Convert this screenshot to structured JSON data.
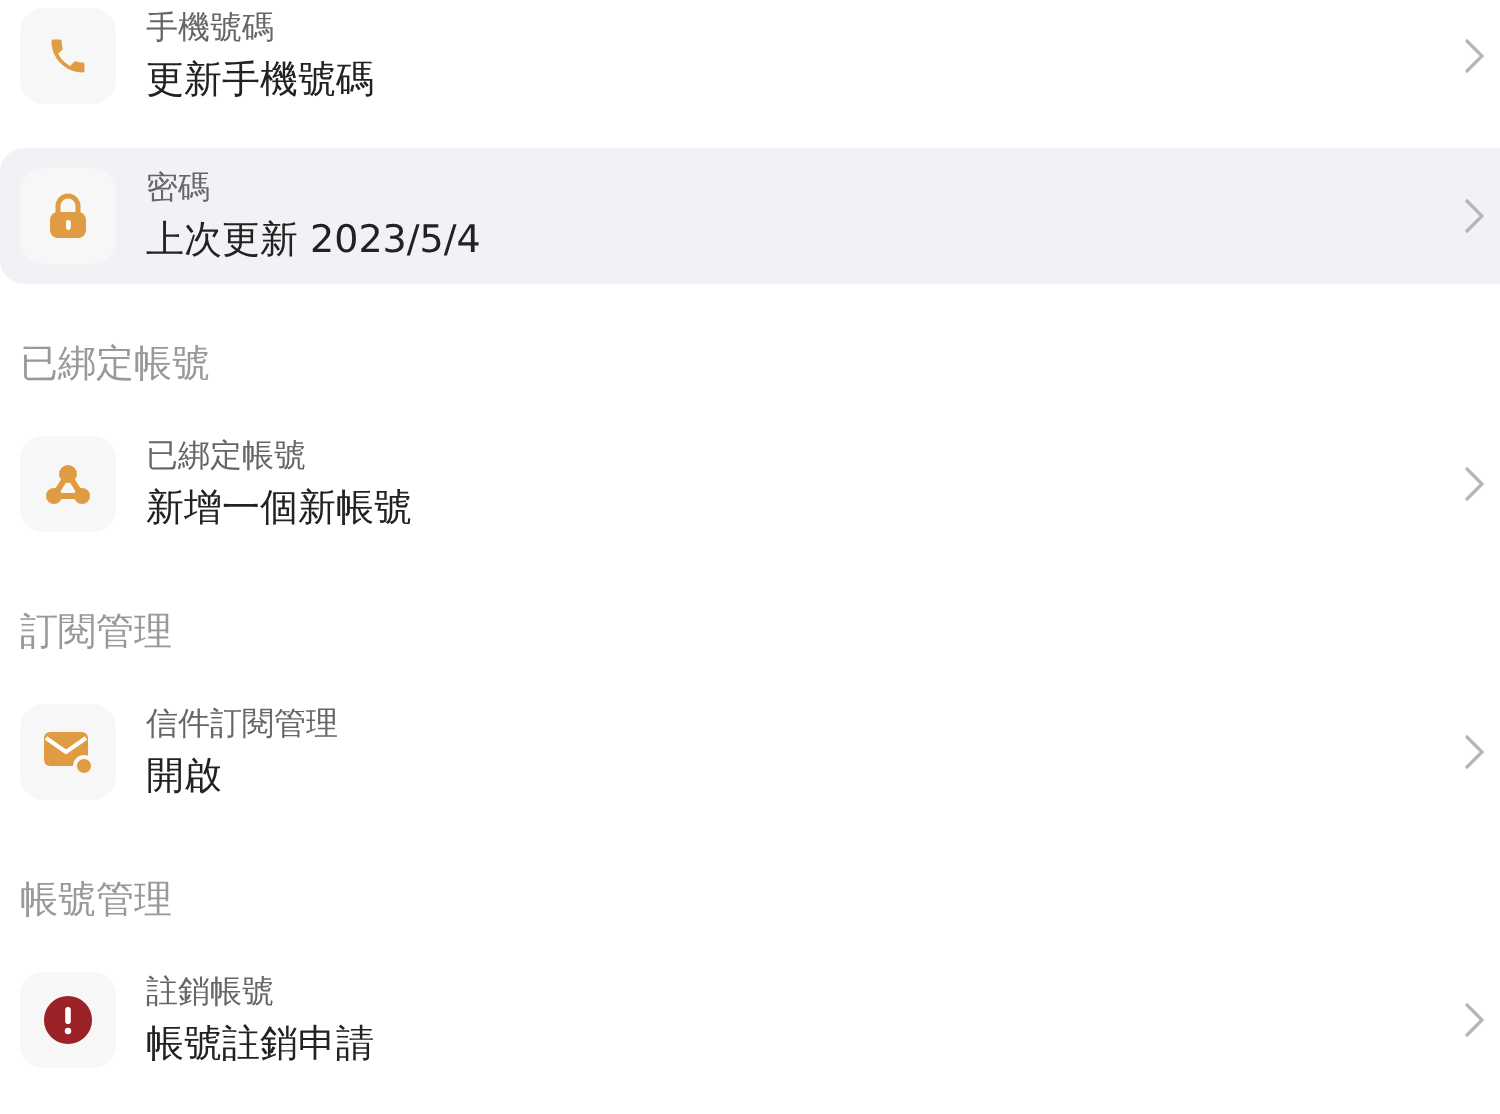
{
  "sections": [
    {
      "items": [
        {
          "kind": "phone",
          "title": "手機號碼",
          "value": "更新手機號碼",
          "selected": false
        },
        {
          "kind": "lock",
          "title": "密碼",
          "value": "上次更新 2023/5/4",
          "selected": true
        }
      ]
    },
    {
      "header": "已綁定帳號",
      "items": [
        {
          "kind": "link",
          "title": "已綁定帳號",
          "value": "新增一個新帳號",
          "selected": false
        }
      ]
    },
    {
      "header": "訂閱管理",
      "items": [
        {
          "kind": "mail",
          "title": "信件訂閱管理",
          "value": "開啟",
          "selected": false
        }
      ]
    },
    {
      "header": "帳號管理",
      "items": [
        {
          "kind": "alert",
          "title": "註銷帳號",
          "value": "帳號註銷申請",
          "selected": false
        }
      ]
    }
  ]
}
